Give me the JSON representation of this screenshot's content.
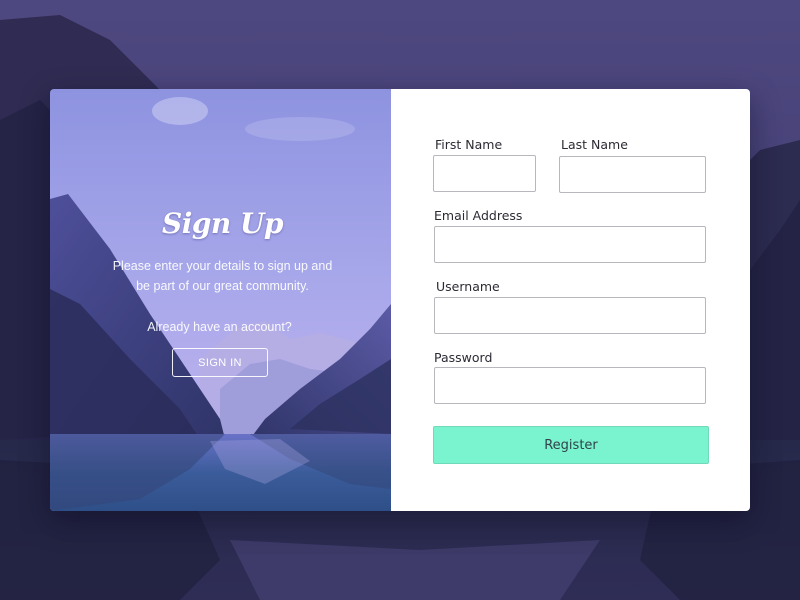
{
  "hero": {
    "title": "Sign Up",
    "description": "Please enter your details to sign up and be part of our great community.",
    "account_question": "Already have an account?",
    "signin_label": "SIGN IN"
  },
  "form": {
    "first_name": {
      "label": "First Name",
      "value": "",
      "placeholder": ""
    },
    "last_name": {
      "label": "Last Name",
      "value": "",
      "placeholder": ""
    },
    "email": {
      "label": "Email Address",
      "value": "",
      "placeholder": ""
    },
    "username": {
      "label": "Username",
      "value": "",
      "placeholder": ""
    },
    "password": {
      "label": "Password",
      "value": "",
      "placeholder": ""
    },
    "register_label": "Register"
  },
  "colors": {
    "accent": "#7af4cf",
    "panel": "#ffffff",
    "backdrop": "#3c3866",
    "hero_tint": "#8d8ae0"
  }
}
